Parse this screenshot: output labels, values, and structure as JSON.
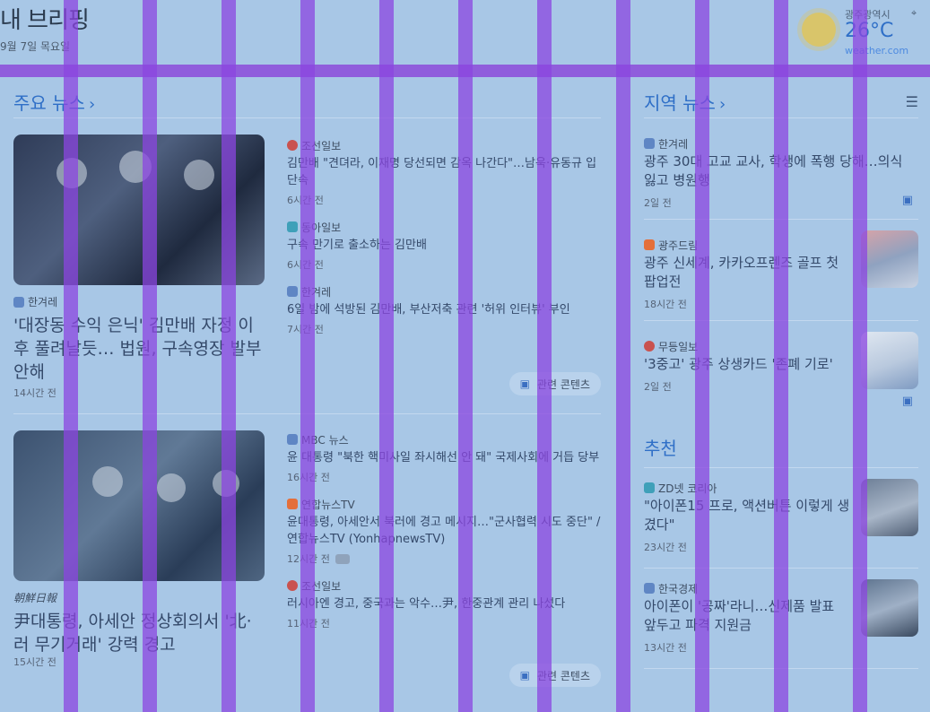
{
  "header": {
    "title": "내 브리핑",
    "date": "9월 7일 목요일"
  },
  "weather": {
    "location": "광주광역시",
    "temp": "26°C",
    "source": "weather.com"
  },
  "top_news": {
    "title": "주요 뉴스",
    "stories": [
      {
        "main": {
          "source": "한겨레",
          "headline": "'대장동 수익 은닉' 김만배 자정 이후 풀려날듯… 법원, 구속영장 발부 안해",
          "time": "14시간 전"
        },
        "subs": [
          {
            "source": "조선일보",
            "headline": "김만배 \"견뎌라, 이재명 당선되면 감옥 나간다\"…남욱·유동규 입단속",
            "time": "6시간 전"
          },
          {
            "source": "동아일보",
            "headline": "구속 만기로 출소하는 김만배",
            "time": "6시간 전"
          },
          {
            "source": "한겨레",
            "headline": "6일 밤에 석방된 김만배, 부산저축 관련 '허위 인터뷰' 부인",
            "time": "7시간 전"
          }
        ],
        "related": "관련 콘텐츠"
      },
      {
        "main": {
          "source": "朝鮮日報",
          "headline": "尹대통령, 아세안 정상회의서 '北·러 무기거래' 강력 경고",
          "time": "15시간 전"
        },
        "subs": [
          {
            "source": "MBC 뉴스",
            "headline": "윤 대통령 \"북한 핵미사일 좌시해선 안 돼\" 국제사회에 거듭 당부",
            "time": "16시간 전"
          },
          {
            "source": "연합뉴스TV",
            "headline": "윤대통령, 아세안서 북러에 경고 메시지…\"군사협력 시도 중단\" / 연합뉴스TV (YonhapnewsTV)",
            "time": "12시간 전"
          },
          {
            "source": "조선일보",
            "headline": "러시아엔 경고, 중국과는 악수…尹, 한중관계 관리 나섰다",
            "time": "11시간 전"
          }
        ],
        "related": "관련 콘텐츠"
      }
    ]
  },
  "local_news": {
    "title": "지역 뉴스",
    "items": [
      {
        "source": "한겨레",
        "headline": "광주 30대 고교 교사, 학생에 폭행 당해…의식 잃고 병원행",
        "time": "2일 전"
      },
      {
        "source": "광주드림",
        "headline": "광주 신세계, 카카오프렌즈 골프 첫 팝업전",
        "time": "18시간 전"
      },
      {
        "source": "무등일보",
        "headline": "'3중고' 광주 상생카드 '존폐 기로'",
        "time": "2일 전"
      }
    ]
  },
  "recommended": {
    "title": "추천",
    "items": [
      {
        "source": "ZD넷 코리아",
        "headline": "\"아이폰15 프로, 액션버튼 이렇게 생겼다\"",
        "time": "23시간 전"
      },
      {
        "source": "한국경제",
        "headline": "아이폰이 '공짜'라니…신제품 발표 앞두고 파격 지원금",
        "time": "13시간 전"
      }
    ]
  },
  "colors": {
    "background": "#a8c7e6",
    "accent": "#2f6fc7",
    "overlay": "#8b45e0"
  },
  "icons": {
    "location": "location-pin-icon",
    "sun": "sun-icon",
    "chevron": "chevron-right-icon",
    "tune": "tune-icon",
    "related": "related-content-icon",
    "play": "video-play-icon"
  }
}
